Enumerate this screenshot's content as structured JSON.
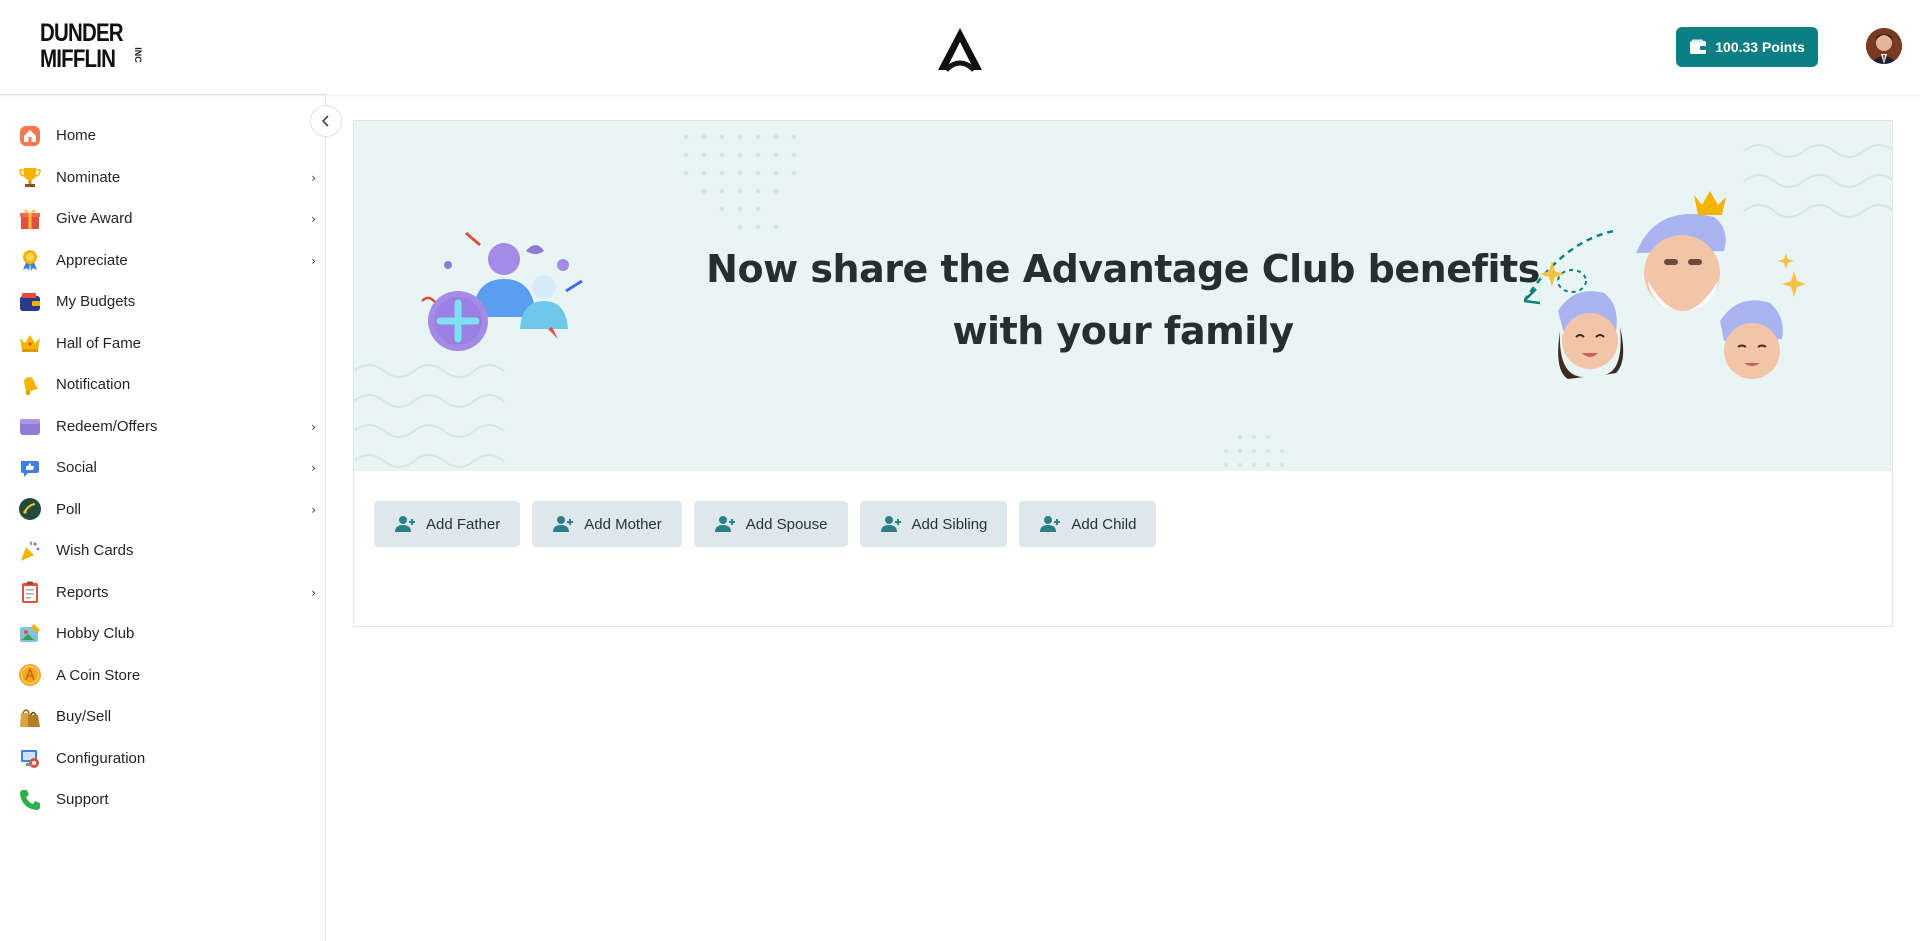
{
  "header": {
    "logo_line1": "DUNDER",
    "logo_line2": "MIFFLIN",
    "logo_suffix": "INC",
    "points_label": "100.33  Points"
  },
  "sidebar": {
    "items": [
      {
        "label": "Home",
        "icon": "home-icon",
        "has_submenu": false
      },
      {
        "label": "Nominate",
        "icon": "trophy-icon",
        "has_submenu": true
      },
      {
        "label": "Give Award",
        "icon": "gift-icon",
        "has_submenu": true
      },
      {
        "label": "Appreciate",
        "icon": "medal-icon",
        "has_submenu": true
      },
      {
        "label": "My Budgets",
        "icon": "wallet-icon",
        "has_submenu": false
      },
      {
        "label": "Hall of Fame",
        "icon": "crown-icon",
        "has_submenu": false
      },
      {
        "label": "Notification",
        "icon": "bell-icon",
        "has_submenu": false
      },
      {
        "label": "Redeem/Offers",
        "icon": "purse-icon",
        "has_submenu": true
      },
      {
        "label": "Social",
        "icon": "thumbs-up-icon",
        "has_submenu": true
      },
      {
        "label": "Poll",
        "icon": "poll-icon",
        "has_submenu": true
      },
      {
        "label": "Wish Cards",
        "icon": "party-popper-icon",
        "has_submenu": false
      },
      {
        "label": "Reports",
        "icon": "clipboard-icon",
        "has_submenu": true
      },
      {
        "label": "Hobby Club",
        "icon": "paint-icon",
        "has_submenu": false
      },
      {
        "label": "A Coin Store",
        "icon": "coin-icon",
        "has_submenu": false
      },
      {
        "label": "Buy/Sell",
        "icon": "shopping-bags-icon",
        "has_submenu": false
      },
      {
        "label": "Configuration",
        "icon": "config-icon",
        "has_submenu": false
      },
      {
        "label": "Support",
        "icon": "phone-icon",
        "has_submenu": false
      }
    ],
    "chevron": "›"
  },
  "banner": {
    "title_line1": "Now share the Advantage Club benefits",
    "title_line2": "with your family"
  },
  "actions": {
    "buttons": [
      {
        "label": "Add Father"
      },
      {
        "label": "Add Mother"
      },
      {
        "label": "Add Spouse"
      },
      {
        "label": "Add Sibling"
      },
      {
        "label": "Add Child"
      }
    ]
  },
  "colors": {
    "accent": "#0d7e83",
    "banner_bg": "#e9f5f5",
    "button_bg": "#dde7ec"
  }
}
